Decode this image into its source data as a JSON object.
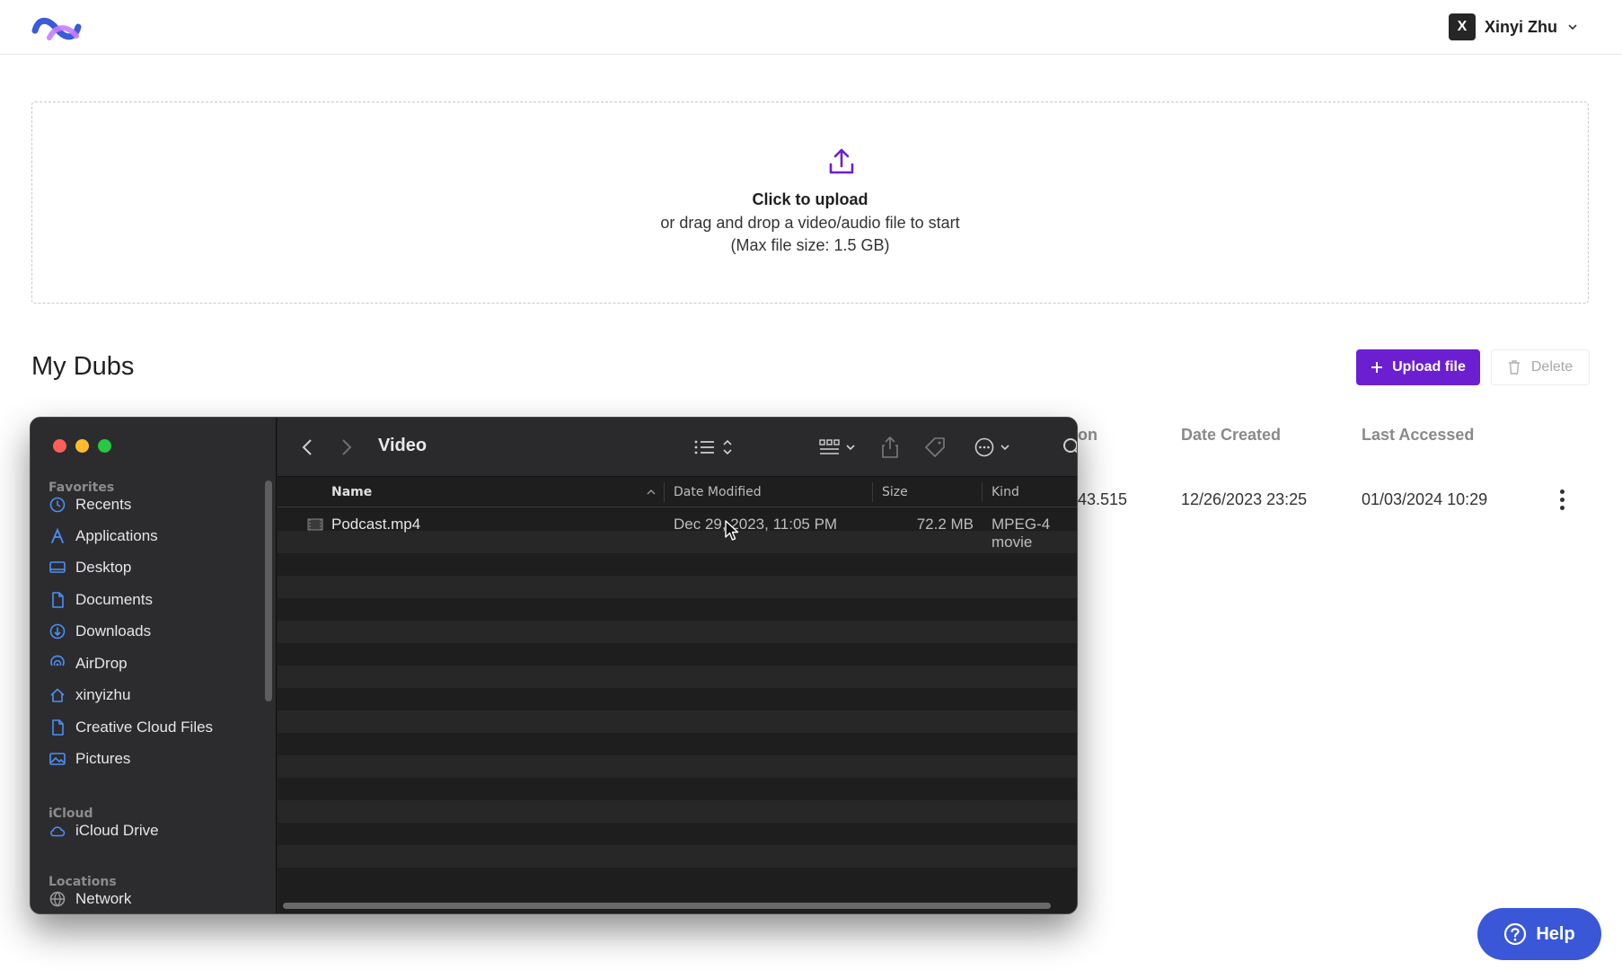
{
  "header": {
    "logo_name": "app-logo",
    "user_initial": "X",
    "user_name": "Xinyi Zhu"
  },
  "upload": {
    "title": "Click to upload",
    "subtitle": "or drag and drop a video/audio file to start",
    "max_size": "(Max file size: 1.5 GB)"
  },
  "dubs": {
    "title": "My Dubs",
    "upload_button": "Upload file",
    "delete_button": "Delete",
    "columns": [
      "on",
      "Date Created",
      "Last Accessed"
    ],
    "rows": [
      {
        "partial": "43.515",
        "date_created": "12/26/2023 23:25",
        "last_accessed": "01/03/2024 10:29"
      }
    ]
  },
  "help": {
    "label": "Help"
  },
  "finder": {
    "folder": "Video",
    "sidebar": {
      "favorites_header": "Favorites",
      "favorites": [
        "Recents",
        "Applications",
        "Desktop",
        "Documents",
        "Downloads",
        "AirDrop",
        "xinyizhu",
        "Creative Cloud Files",
        "Pictures"
      ],
      "icloud_header": "iCloud",
      "icloud": [
        "iCloud Drive"
      ],
      "locations_header": "Locations",
      "locations": [
        "Network"
      ]
    },
    "columns": {
      "name": "Name",
      "date_modified": "Date Modified",
      "size": "Size",
      "kind": "Kind"
    },
    "files": [
      {
        "name": "Podcast.mp4",
        "date_modified": "Dec 29, 2023, 11:05 PM",
        "size": "72.2 MB",
        "kind": "MPEG-4 movie"
      }
    ]
  },
  "colors": {
    "accent": "#6c1fd1",
    "help": "#3a57d8",
    "finder_bg": "#1e1e1e",
    "traffic_red": "#fe5f57",
    "traffic_yellow": "#febc2e",
    "traffic_green": "#28c840"
  }
}
